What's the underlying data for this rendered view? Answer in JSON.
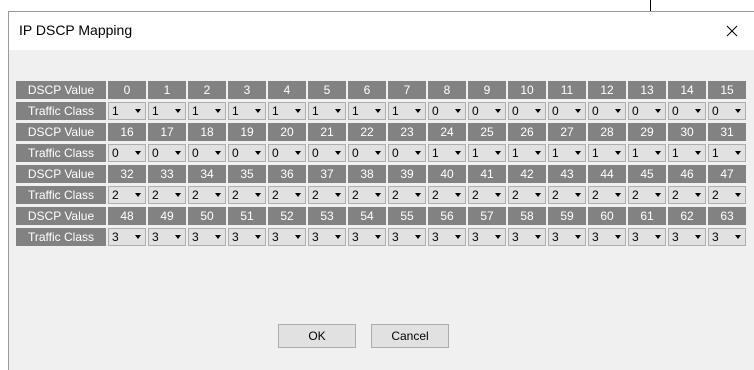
{
  "dialog": {
    "title": "IP DSCP Mapping",
    "close_symbol": "×",
    "close_icon": "close-icon"
  },
  "labels": {
    "dscp_value": "DSCP Value",
    "traffic_class": "Traffic Class"
  },
  "mapping_rows": [
    {
      "dscp_values": [
        "0",
        "1",
        "2",
        "3",
        "4",
        "5",
        "6",
        "7",
        "8",
        "9",
        "10",
        "11",
        "12",
        "13",
        "14",
        "15"
      ],
      "traffic_classes": [
        "1",
        "1",
        "1",
        "1",
        "1",
        "1",
        "1",
        "1",
        "0",
        "0",
        "0",
        "0",
        "0",
        "0",
        "0",
        "0"
      ]
    },
    {
      "dscp_values": [
        "16",
        "17",
        "18",
        "19",
        "20",
        "21",
        "22",
        "23",
        "24",
        "25",
        "26",
        "27",
        "28",
        "29",
        "30",
        "31"
      ],
      "traffic_classes": [
        "0",
        "0",
        "0",
        "0",
        "0",
        "0",
        "0",
        "0",
        "1",
        "1",
        "1",
        "1",
        "1",
        "1",
        "1",
        "1"
      ]
    },
    {
      "dscp_values": [
        "32",
        "33",
        "34",
        "35",
        "36",
        "37",
        "38",
        "39",
        "40",
        "41",
        "42",
        "43",
        "44",
        "45",
        "46",
        "47"
      ],
      "traffic_classes": [
        "2",
        "2",
        "2",
        "2",
        "2",
        "2",
        "2",
        "2",
        "2",
        "2",
        "2",
        "2",
        "2",
        "2",
        "2",
        "2"
      ]
    },
    {
      "dscp_values": [
        "48",
        "49",
        "50",
        "51",
        "52",
        "53",
        "54",
        "55",
        "56",
        "57",
        "58",
        "59",
        "60",
        "61",
        "62",
        "63"
      ],
      "traffic_classes": [
        "3",
        "3",
        "3",
        "3",
        "3",
        "3",
        "3",
        "3",
        "3",
        "3",
        "3",
        "3",
        "3",
        "3",
        "3",
        "3"
      ]
    }
  ],
  "buttons": {
    "ok_label": "OK",
    "cancel_label": "Cancel"
  },
  "colors": {
    "header_cell_bg": "#828282",
    "header_cell_text": "#ffffff",
    "dialog_bg": "#f0f0f0",
    "button_bg": "#e1e1e1"
  }
}
